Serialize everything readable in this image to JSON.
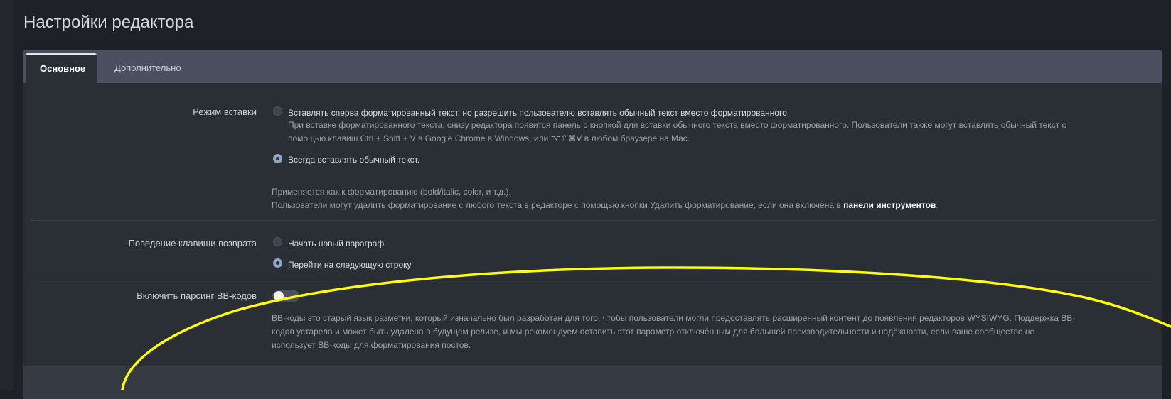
{
  "page": {
    "title": "Настройки редактора"
  },
  "tabs": [
    {
      "label": "Основное",
      "active": true
    },
    {
      "label": "Дополнительно",
      "active": false
    }
  ],
  "paste_mode": {
    "label": "Режим вставки",
    "options": [
      {
        "label": "Вставлять сперва форматированный текст, но разрешить пользователю вставлять обычный текст вместо форматированного.",
        "selected": false,
        "help_line1": "При вставке форматированного текста, снизу редактора появится панель с кнопкой для вставки обычного текста вместо форматированного. Пользователи также могут вставлять обычный текст с",
        "help_line2": "помощью клавиш Ctrl + Shift + V в Google Chrome в Windows, или ⌥⇧⌘V в любом браузере на Mac."
      },
      {
        "label": "Всегда вставлять обычный текст.",
        "selected": true
      }
    ],
    "note_line1": "Применяется как к форматированию (bold/italic, color, и т.д.).",
    "note_line2_before": "Пользователи могут удалить форматирование с любого текста в редакторе с помощью кнопки Удалить форматирование, если она включена в ",
    "note_link": "панели инструментов",
    "note_line2_after": "."
  },
  "return_key": {
    "label": "Поведение клавиши возврата",
    "options": [
      {
        "label": "Начать новый параграф",
        "selected": false
      },
      {
        "label": "Перейти на следующую строку",
        "selected": true
      }
    ]
  },
  "bbcode": {
    "label": "Включить парсинг BB-кодов",
    "enabled": false,
    "help_line1": "BB-коды это старый язык разметки, который изначально был разработан для того, чтобы пользователи могли предоставлять расширенный контент до появления редакторов WYSIWYG. Поддержка BB-",
    "help_line2": "кодов устарела и может быть удалена в будущем релизе, и мы рекомендуем оставить этот параметр отключённым для большей производительности и надёжности, если ваше сообщество не",
    "help_line3": "использует BB-коды для форматирования постов."
  },
  "colors": {
    "background": "#1e2126",
    "panel": "#2a2e35",
    "tab_bar": "#4a5060",
    "radio_checked": "#8ea7c7",
    "annotation": "#ffff00"
  }
}
